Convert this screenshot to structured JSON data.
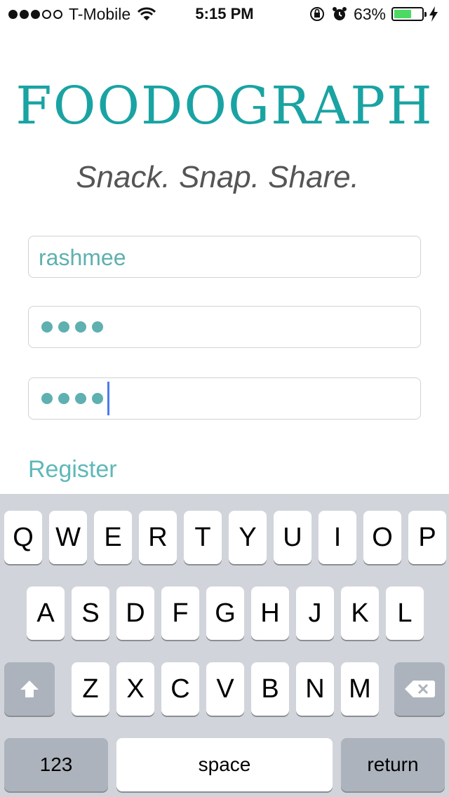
{
  "status_bar": {
    "carrier": "T-Mobile",
    "signal_dots_filled": 3,
    "signal_dots_total": 5,
    "time": "5:15 PM",
    "battery_percent": "63%",
    "battery_level": 0.63
  },
  "app": {
    "logo": "FOODOGRAPH",
    "tagline": "Snack. Snap. Share.",
    "accent_color": "#1aa3a3"
  },
  "form": {
    "username": "rashmee",
    "password_dots": 4,
    "confirm_password_dots": 4,
    "register_link": "Register"
  },
  "keyboard": {
    "row1": [
      "Q",
      "W",
      "E",
      "R",
      "T",
      "Y",
      "U",
      "I",
      "O",
      "P"
    ],
    "row2": [
      "A",
      "S",
      "D",
      "F",
      "G",
      "H",
      "J",
      "K",
      "L"
    ],
    "row3": [
      "Z",
      "X",
      "C",
      "V",
      "B",
      "N",
      "M"
    ],
    "numbers_key": "123",
    "space_key": "space",
    "return_key": "return"
  }
}
